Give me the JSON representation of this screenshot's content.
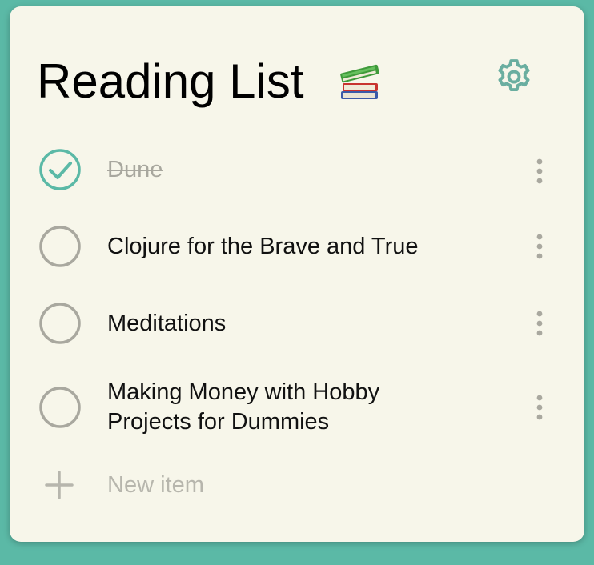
{
  "header": {
    "title": "Reading List",
    "icon": "books-icon",
    "settings_icon": "gear-icon"
  },
  "items": [
    {
      "label": "Dune",
      "done": true
    },
    {
      "label": "Clojure for the Brave and True",
      "done": false
    },
    {
      "label": "Meditations",
      "done": false
    },
    {
      "label": "Making Money with Hobby Projects for Dummies",
      "done": false
    }
  ],
  "new_item": {
    "placeholder": "New item",
    "icon": "plus-icon"
  },
  "colors": {
    "background": "#5bb9a6",
    "card": "#f7f6ea",
    "accent": "#5bb9a6",
    "gear": "#6aaea0",
    "unchecked": "#a9a89f",
    "muted_text": "#b7b6ad"
  }
}
